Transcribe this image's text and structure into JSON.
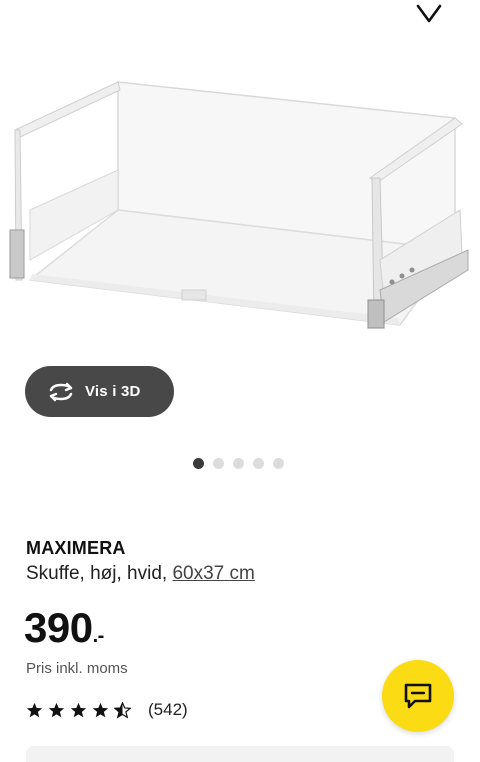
{
  "icons": {
    "favorite": "heart-icon",
    "rotate_3d": "rotate-3d-icon",
    "chat": "chat-icon",
    "star_full": "star-icon",
    "star_half": "star-half-icon"
  },
  "gallery": {
    "vis3d_label": "Vis i 3D",
    "dots_total": 5,
    "active_dot": 1
  },
  "product": {
    "brand": "MAXIMERA",
    "description": "Skuffe, høj, hvid, ",
    "size": "60x37 cm",
    "price": "390",
    "price_suffix": ".-",
    "vat_note": "Pris inkl. moms",
    "rating_value": 4.5,
    "rating_count": "(542)"
  },
  "colors": {
    "accent_yellow": "#fadb14",
    "button_dark": "#484848"
  }
}
